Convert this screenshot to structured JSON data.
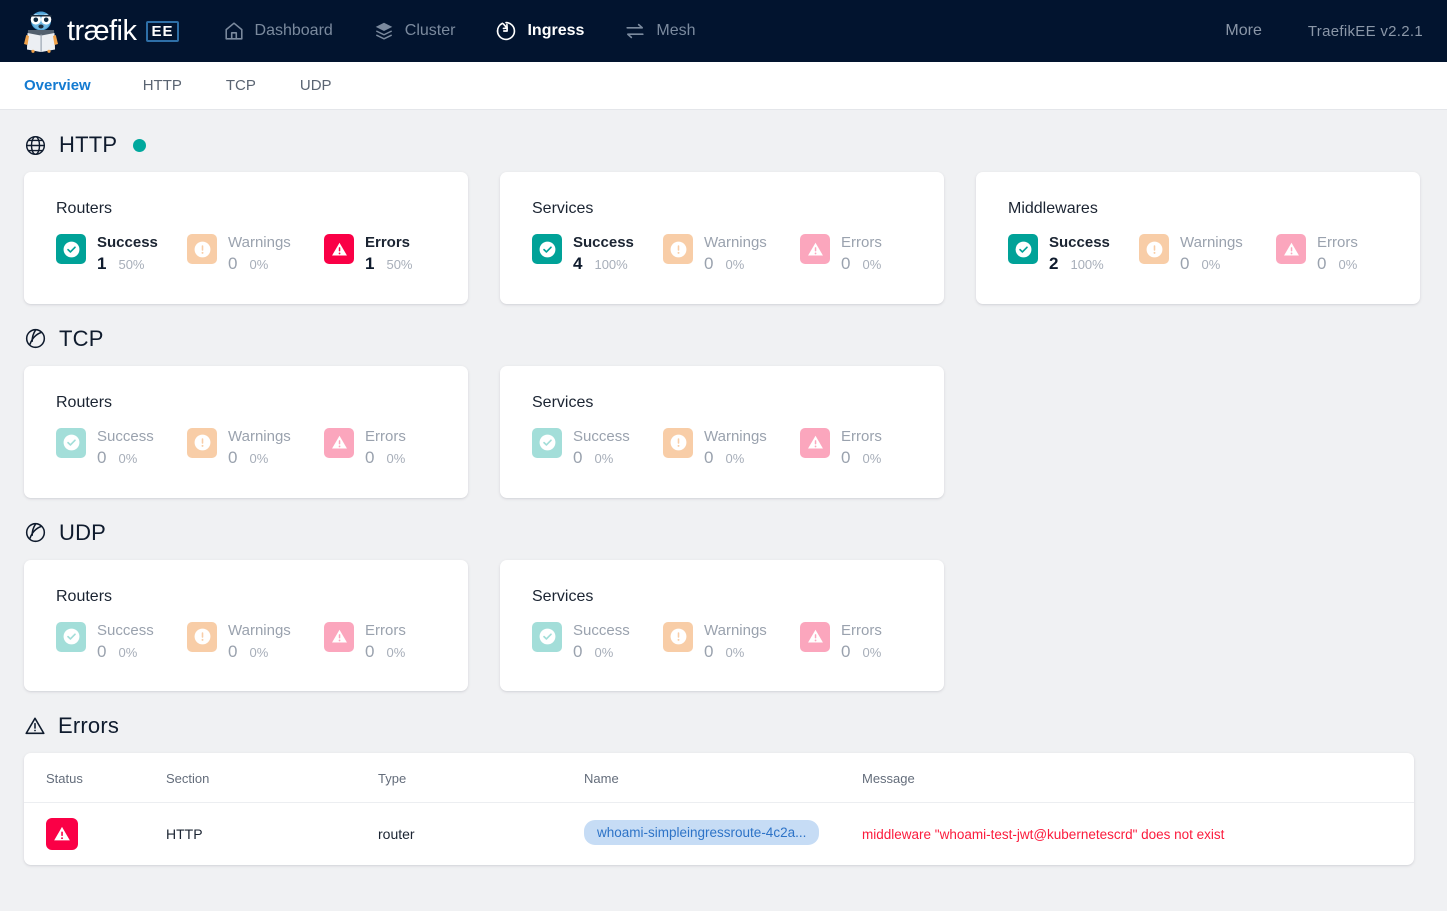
{
  "header": {
    "brand_word": "træfik",
    "brand_badge": "EE",
    "brand_icon": "traefik-gopher-logo",
    "nav": [
      {
        "label": "Dashboard",
        "icon": "home-icon",
        "active": false
      },
      {
        "label": "Cluster",
        "icon": "layers-icon",
        "active": false
      },
      {
        "label": "Ingress",
        "icon": "ingress-arrow-circle-icon",
        "active": true
      },
      {
        "label": "Mesh",
        "icon": "exchange-arrows-icon",
        "active": false
      }
    ],
    "more_label": "More",
    "version": "TraefikEE  v2.2.1",
    "bg_color": "#02142f"
  },
  "tabs": [
    {
      "label": "Overview",
      "active": true
    },
    {
      "label": "HTTP",
      "active": false
    },
    {
      "label": "TCP",
      "active": false
    },
    {
      "label": "UDP",
      "active": false
    }
  ],
  "stat_labels": {
    "success": "Success",
    "warnings": "Warnings",
    "errors": "Errors"
  },
  "sections": [
    {
      "title": "HTTP",
      "icon": "globe-icon",
      "status_dot": true,
      "status_dot_color": "#00a89d",
      "cards": [
        {
          "title": "Routers",
          "success": {
            "count": "1",
            "pct": "50%",
            "active": true
          },
          "warnings": {
            "count": "0",
            "pct": "0%",
            "active": false
          },
          "errors": {
            "count": "1",
            "pct": "50%",
            "active": true
          }
        },
        {
          "title": "Services",
          "success": {
            "count": "4",
            "pct": "100%",
            "active": true
          },
          "warnings": {
            "count": "0",
            "pct": "0%",
            "active": false
          },
          "errors": {
            "count": "0",
            "pct": "0%",
            "active": false
          }
        },
        {
          "title": "Middlewares",
          "success": {
            "count": "2",
            "pct": "100%",
            "active": true
          },
          "warnings": {
            "count": "0",
            "pct": "0%",
            "active": false
          },
          "errors": {
            "count": "0",
            "pct": "0%",
            "active": false
          }
        }
      ]
    },
    {
      "title": "TCP",
      "icon": "network-circle-icon",
      "status_dot": false,
      "cards": [
        {
          "title": "Routers",
          "success": {
            "count": "0",
            "pct": "0%",
            "active": false
          },
          "warnings": {
            "count": "0",
            "pct": "0%",
            "active": false
          },
          "errors": {
            "count": "0",
            "pct": "0%",
            "active": false
          }
        },
        {
          "title": "Services",
          "success": {
            "count": "0",
            "pct": "0%",
            "active": false
          },
          "warnings": {
            "count": "0",
            "pct": "0%",
            "active": false
          },
          "errors": {
            "count": "0",
            "pct": "0%",
            "active": false
          }
        }
      ]
    },
    {
      "title": "UDP",
      "icon": "network-circle-icon",
      "status_dot": false,
      "cards": [
        {
          "title": "Routers",
          "success": {
            "count": "0",
            "pct": "0%",
            "active": false
          },
          "warnings": {
            "count": "0",
            "pct": "0%",
            "active": false
          },
          "errors": {
            "count": "0",
            "pct": "0%",
            "active": false
          }
        },
        {
          "title": "Services",
          "success": {
            "count": "0",
            "pct": "0%",
            "active": false
          },
          "warnings": {
            "count": "0",
            "pct": "0%",
            "active": false
          },
          "errors": {
            "count": "0",
            "pct": "0%",
            "active": false
          }
        }
      ]
    }
  ],
  "errors_panel": {
    "title": "Errors",
    "icon": "warning-triangle-icon",
    "columns": [
      "Status",
      "Section",
      "Type",
      "Name",
      "Message"
    ],
    "rows": [
      {
        "status_icon": "error-badge-icon",
        "section": "HTTP",
        "type": "router",
        "name": "whoami-simpleingressroute-4c2a...",
        "message": "middleware \"whoami-test-jwt@kubernetescrd\" does not exist"
      }
    ]
  },
  "colors": {
    "success": "#00a298",
    "success_muted": "#a3ded9",
    "warning": "#f8cda7",
    "error": "#fa0046",
    "error_muted": "#fba6bd",
    "accent_link": "#147bd1",
    "page_bg": "#f0f1f3"
  }
}
